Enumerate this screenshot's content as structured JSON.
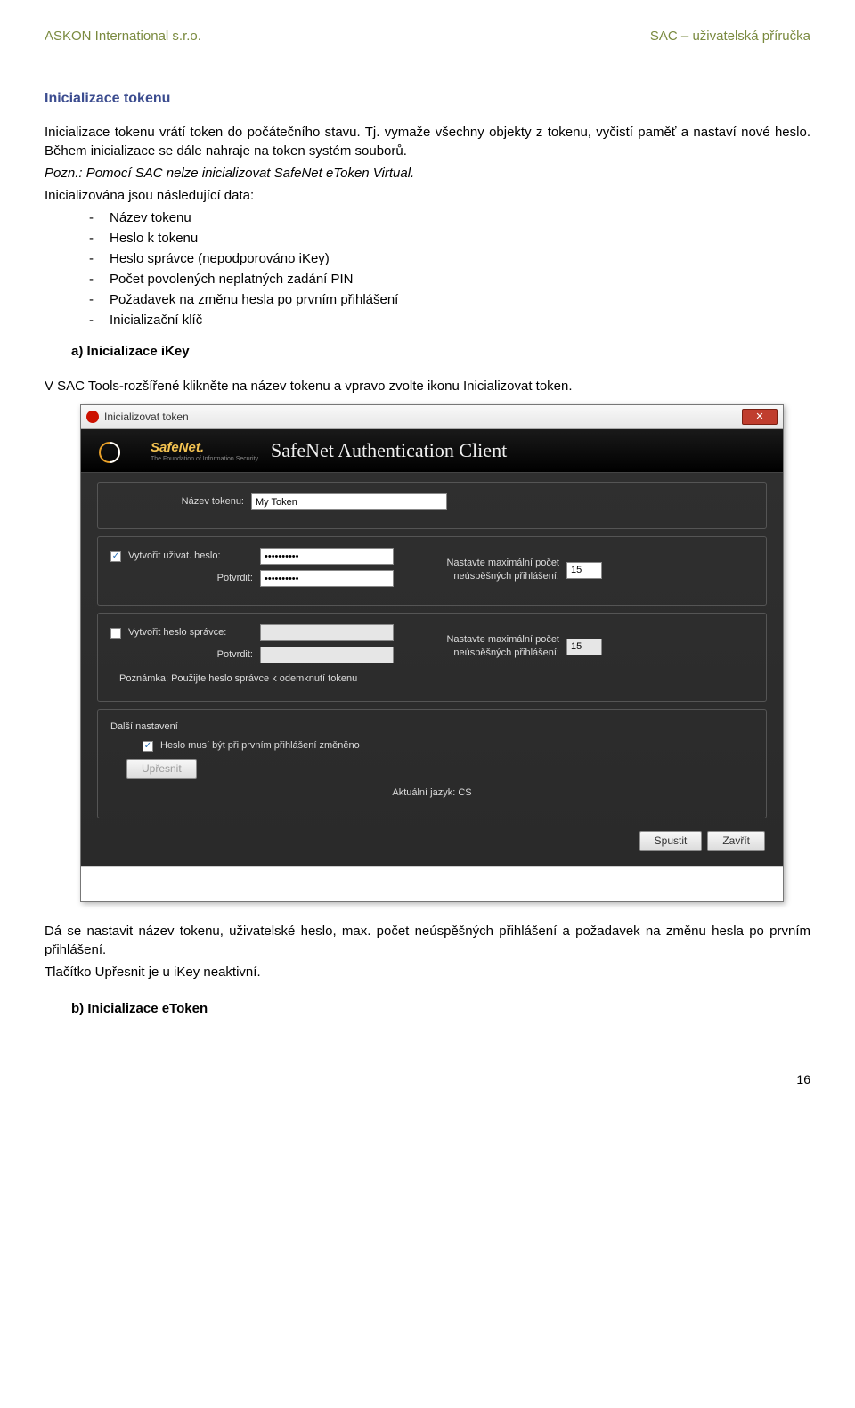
{
  "header": {
    "left": "ASKON International s.r.o.",
    "right": "SAC – uživatelská příručka"
  },
  "section": {
    "title": "Inicializace tokenu",
    "p1": "Inicializace tokenu vrátí token do počátečního stavu. Tj. vymaže všechny objekty z tokenu, vyčistí paměť a nastaví nové heslo. Během inicializace se dále nahraje na token systém souborů.",
    "p2_italic": "Pozn.: Pomocí SAC nelze inicializovat SafeNet eToken Virtual.",
    "p3": "Inicializována jsou následující data:",
    "bullets": [
      "Název tokenu",
      "Heslo k tokenu",
      "Heslo správce (nepodporováno iKey)",
      "Počet povolených neplatných zadání PIN",
      "Požadavek na změnu hesla po prvním přihlášení",
      "Inicializační klíč"
    ],
    "sub_a": "a)  Inicializace iKey",
    "p4": "V SAC Tools-rozšířené klikněte na název tokenu a vpravo zvolte ikonu Inicializovat token.",
    "post_p1": "Dá se nastavit název tokenu, uživatelské heslo, max. počet neúspěšných přihlášení a požadavek na změnu hesla po prvním přihlášení.",
    "post_p2": "Tlačítko Upřesnit je u iKey neaktivní.",
    "sub_b": "b)  Inicializace eToken"
  },
  "dialog": {
    "title": "Inicializovat token",
    "brand": "SafeNet Authentication Client",
    "brand_logo_text": "SafeNet.",
    "token_name_label": "Název tokenu:",
    "token_name_value": "My Token",
    "create_user_pwd": "Vytvořit uživat. heslo:",
    "confirm_label": "Potvrdit:",
    "pwd_value": "••••••••••",
    "max_fail_label": "Nastavte maximální počet neúspěšných přihlášení:",
    "max_fail_value_1": "15",
    "max_fail_value_2": "15",
    "create_admin_pwd": "Vytvořit heslo správce:",
    "note_admin": "Poznámka: Použijte heslo správce k odemknutí tokenu",
    "more_settings": "Další nastavení",
    "must_change": "Heslo musí být při prvním přihlášení změněno",
    "btn_detail": "Upřesnit",
    "lang_label": "Aktuální jazyk: CS",
    "btn_start": "Spustit",
    "btn_close": "Zavřít"
  },
  "page_number": "16"
}
